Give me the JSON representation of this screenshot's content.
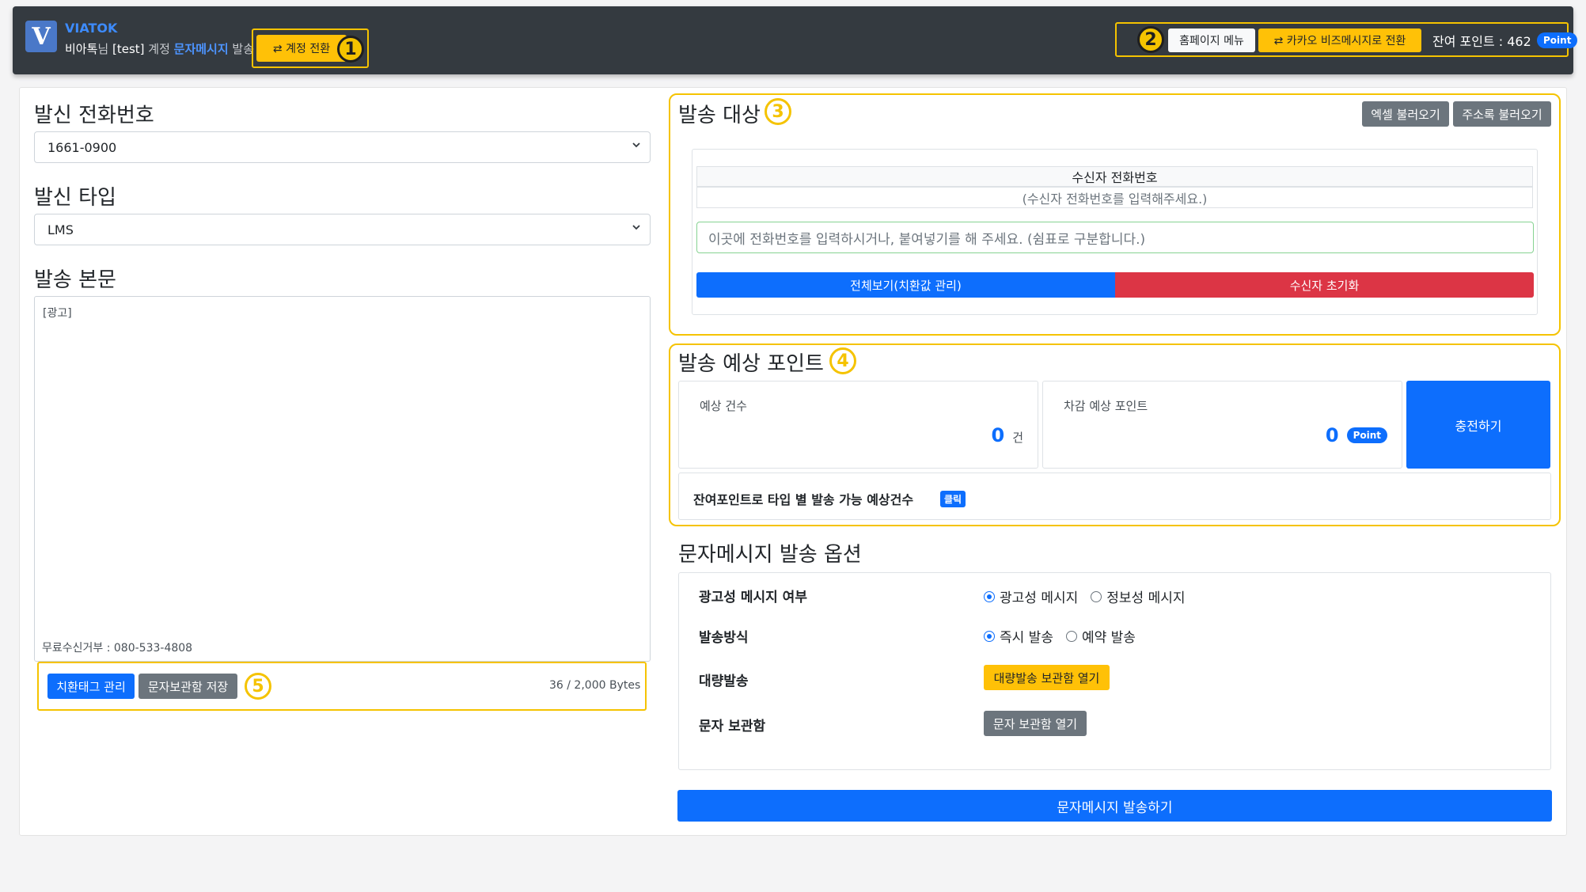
{
  "header": {
    "logo_letter": "V",
    "brand": "VIATOK",
    "user_name": "비아톡",
    "honorific": "님 ",
    "account": "[test]",
    "account_suffix": " 계정 ",
    "service": "문자메시지",
    "service_suffix": " 발송",
    "switch_account_label": "⇄ 계정 전환",
    "home_menu_label": "홈페이지 메뉴",
    "kakao_switch_label": "⇄ 카카오 비즈메시지로 전환",
    "balance_label": "잔여 포인트 : 462",
    "point_badge": "Point"
  },
  "annotations": {
    "n1": "1",
    "n2": "2",
    "n3": "3",
    "n4": "4",
    "n5": "5"
  },
  "left": {
    "sender_title": "발신 전화번호",
    "sender_value": "1661-0900",
    "type_title": "발신 타입",
    "type_value": "LMS",
    "body_title": "발송 본문",
    "body_text": "[광고]",
    "optout_text": "무료수신거부 : 080-533-4808",
    "tag_btn": "치환태그 관리",
    "save_btn": "문자보관함 저장",
    "bytes": "36 / 2,000 Bytes"
  },
  "recipients": {
    "title": "발송 대상",
    "excel_btn": "엑셀 불러오기",
    "address_btn": "주소록 불러오기",
    "col_header": "수신자 전화번호",
    "empty_row": "(수신자 전화번호를 입력해주세요.)",
    "input_placeholder": "이곳에 전화번호를 입력하시거나, 붙여넣기를 해 주세요. (쉼표로 구분합니다.)",
    "view_all_btn": "전체보기(치환값 관리)",
    "reset_btn": "수신자 초기화"
  },
  "estimate": {
    "title": "발송 예상 포인트",
    "count_label": "예상 건수",
    "count_value": "0",
    "count_unit": "건",
    "deduct_label": "차감 예상 포인트",
    "deduct_value": "0",
    "point_badge": "Point",
    "charge_btn": "충전하기",
    "possible_text": "잔여포인트로 타입 별 발송 가능 예상건수",
    "click_badge": "클릭"
  },
  "options": {
    "title": "문자메시지 발송 옵션",
    "ad_label": "광고성 메시지 여부",
    "ad_opt1": "광고성 메시지",
    "ad_opt2": "정보성 메시지",
    "method_label": "발송방식",
    "method_opt1": "즉시 발송",
    "method_opt2": "예약 발송",
    "bulk_label": "대량발송",
    "bulk_btn": "대량발송 보관함 열기",
    "box_label": "문자 보관함",
    "box_btn": "문자 보관함 열기"
  },
  "send_btn": "문자메시지 발송하기",
  "colors": {
    "topbar": "#343a40",
    "accent": "#0d6efd",
    "annotation": "#f5c300",
    "danger": "#dc3545",
    "warning": "#ffc107",
    "secondary": "#6c757d"
  }
}
